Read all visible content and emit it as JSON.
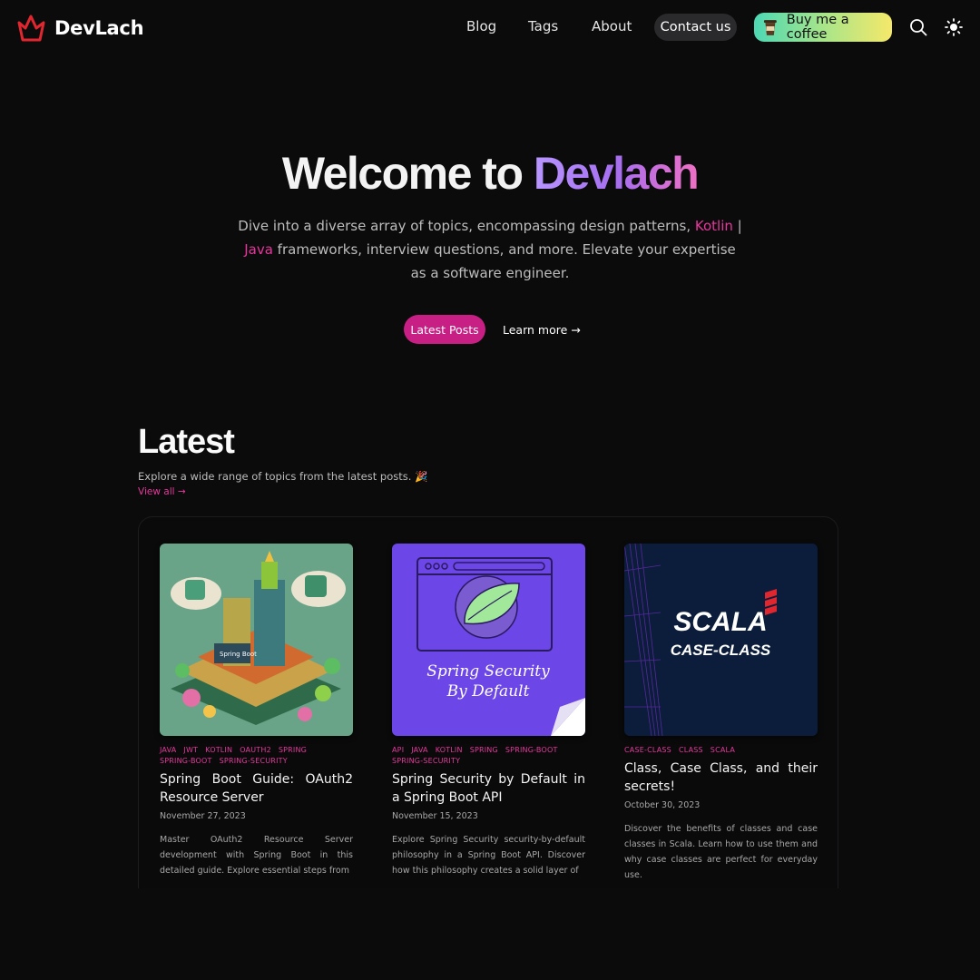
{
  "header": {
    "brand": "DevLach",
    "nav": {
      "blog": "Blog",
      "tags": "Tags",
      "about": "About"
    },
    "contact_label": "Contact us",
    "coffee_label": "Buy me a coffee"
  },
  "hero": {
    "title_prefix": "Welcome to ",
    "title_highlight": "Devlach",
    "desc_part1": "Dive into a diverse array of topics, encompassing design patterns, ",
    "desc_kotlin": "Kotlin",
    "desc_sep": " | ",
    "desc_java": "Java",
    "desc_part2": " frameworks, interview questions, and more. Elevate your expertise as a software engineer.",
    "primary_button": "Latest Posts",
    "secondary_button": "Learn more →"
  },
  "latest": {
    "title": "Latest",
    "subtitle": "Explore a wide range of topics from the latest posts. 🎉",
    "view_all": "View all →"
  },
  "posts": [
    {
      "tags": [
        "JAVA",
        "JWT",
        "KOTLIN",
        "OAUTH2",
        "SPRING",
        "SPRING-BOOT",
        "SPRING-SECURITY"
      ],
      "title": "Spring Boot Guide: OAuth2 Resource Server",
      "date": "November 27, 2023",
      "description": "Master OAuth2 Resource Server development with Spring Boot in this detailed guide. Explore essential steps from",
      "image_label": "Spring Boot"
    },
    {
      "tags": [
        "API",
        "JAVA",
        "KOTLIN",
        "SPRING",
        "SPRING-BOOT",
        "SPRING-SECURITY"
      ],
      "title": "Spring Security by Default in a Spring Boot API",
      "date": "November 15, 2023",
      "description": "Explore Spring Security security-by-default philosophy in a Spring Boot API. Discover how this philosophy creates a solid layer of",
      "image_line1": "Spring Security",
      "image_line2": "By Default"
    },
    {
      "tags": [
        "CASE-CLASS",
        "CLASS",
        "SCALA"
      ],
      "title": "Class, Case Class, and their secrets!",
      "date": "October 30, 2023",
      "description": "Discover the benefits of classes and case classes in Scala. Learn how to use them and why case classes are perfect for everyday use.",
      "image_line1": "SCALA",
      "image_line2": "CASE-CLASS"
    }
  ],
  "colors": {
    "background": "#0b0b0c",
    "accent_pink": "#e8369c",
    "primary_button": "#c71f84",
    "logo_red": "#e0262f"
  },
  "icons": [
    "crown-logo-icon",
    "coffee-cup-icon",
    "search-icon",
    "sun-icon"
  ]
}
